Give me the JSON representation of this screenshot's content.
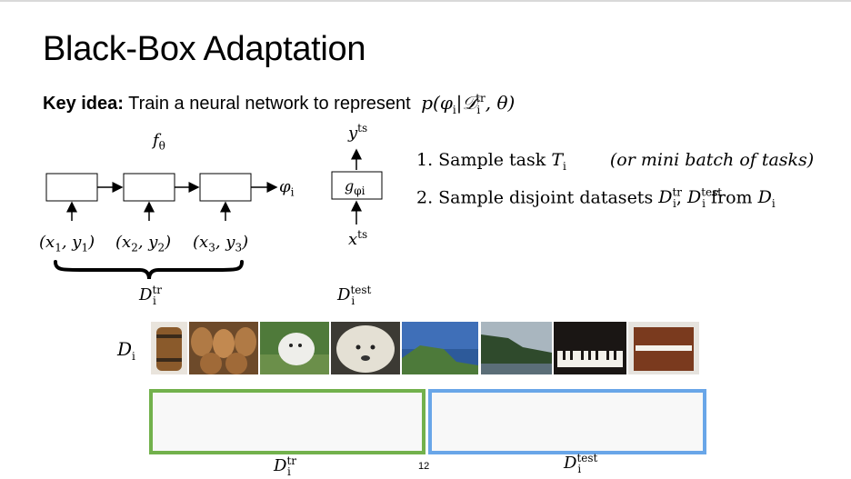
{
  "slide": {
    "title": "Black-Box Adaptation",
    "key_idea_label": "Key idea:",
    "key_idea_text": " Train a neural network to represent ",
    "page_number": "12"
  },
  "diagram": {
    "f_label": "f",
    "f_sub": "θ",
    "phi_out": "φ",
    "phi_sub": "i",
    "inputs": [
      "(x",
      "(x",
      "(x"
    ],
    "input_sub": [
      "1",
      "2",
      "3"
    ],
    "y_mid": [
      ", y",
      ", y",
      ", y"
    ],
    "g_label": "g",
    "g_sub": "φi",
    "y_ts": "y",
    "ts": "ts",
    "x_ts": "x",
    "d_label": "D",
    "tr": "tr",
    "test": "test",
    "i": "i"
  },
  "steps": {
    "step1": "1.  Sample task ",
    "step1_task": "T",
    "step1_note": "(or mini batch of tasks)",
    "step2": "2.  Sample disjoint datasets ",
    "step2_from": " from "
  },
  "images": [
    "barrel",
    "barrels",
    "white dog",
    "shaggy dog",
    "cliff coast",
    "cliffs",
    "piano keys",
    "upright piano"
  ]
}
